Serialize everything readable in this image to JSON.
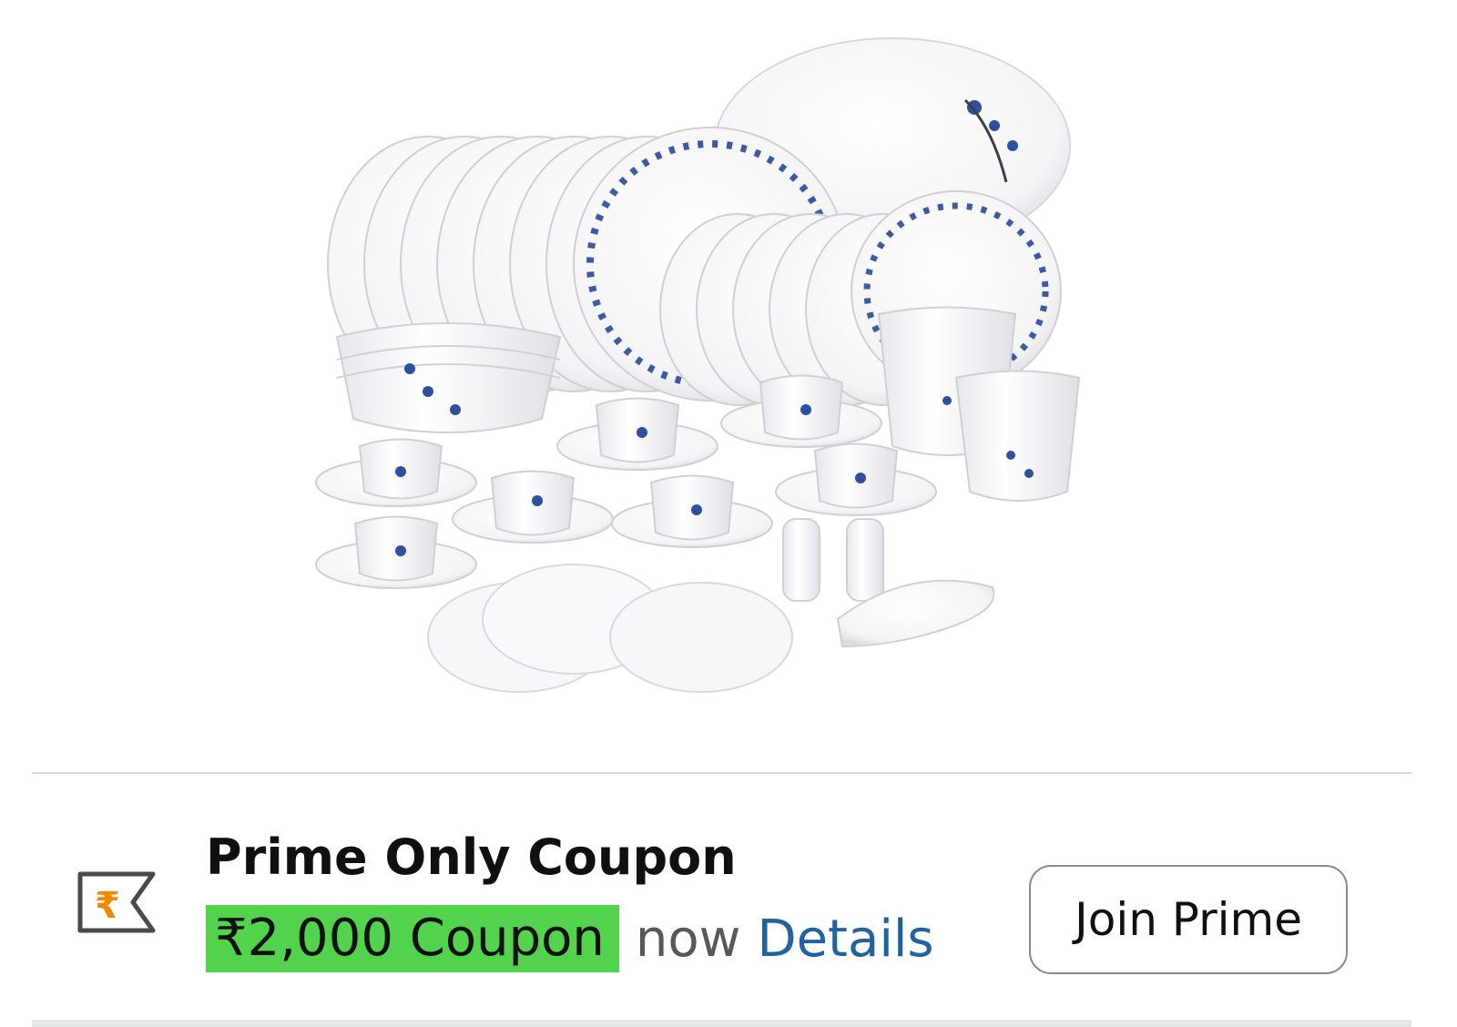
{
  "product_image": {
    "alt_icon": "dinner-set-image"
  },
  "coupon": {
    "title": "Prime Only Coupon",
    "amount": "₹2,000 Coupon",
    "now": "now",
    "details_link": "Details",
    "join_button": "Join Prime",
    "icon": "rupee-tag-icon",
    "colors": {
      "highlight": "#52d24d",
      "link": "#2162a1",
      "rupee": "#f08804"
    }
  }
}
